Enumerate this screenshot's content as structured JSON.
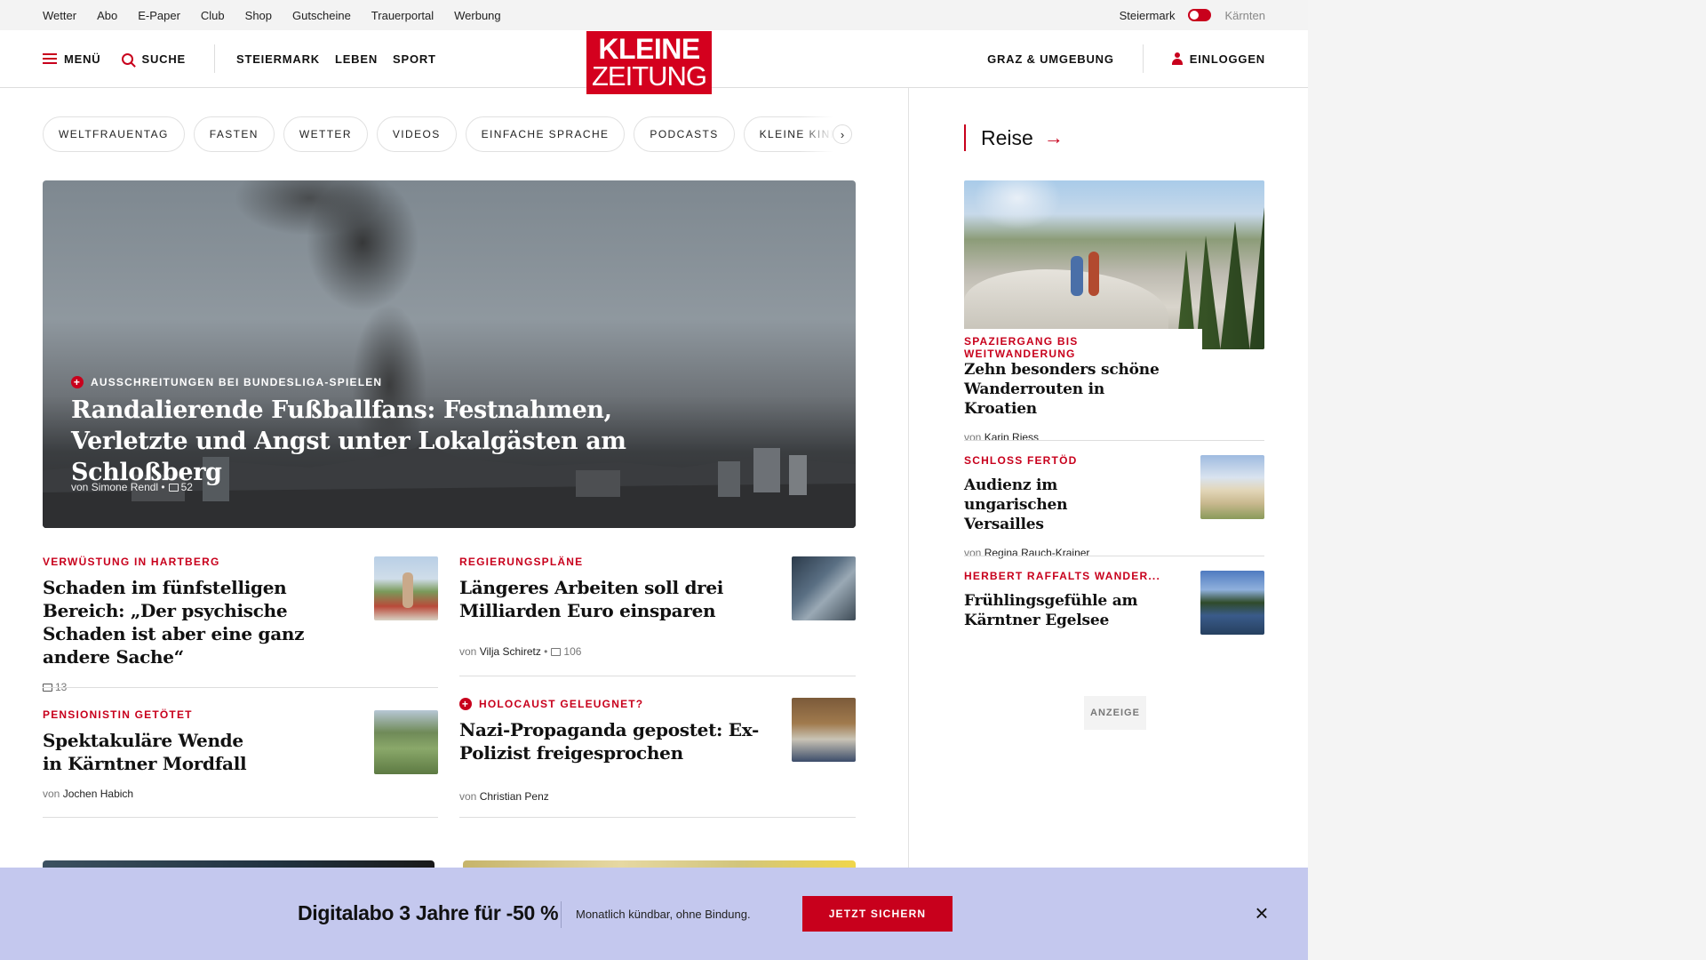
{
  "topbar": {
    "links": [
      "Wetter",
      "Abo",
      "E-Paper",
      "Club",
      "Shop",
      "Gutscheine",
      "Trauerportal",
      "Werbung"
    ],
    "region_active": "Steiermark",
    "region_other": "Kärnten"
  },
  "header": {
    "menu_label": "MENÜ",
    "search_label": "SUCHE",
    "nav": [
      "STEIERMARK",
      "LEBEN",
      "SPORT"
    ],
    "logo_line1": "KLEINE",
    "logo_line2": "ZEITUNG",
    "local_label": "GRAZ & UMGEBUNG",
    "login_label": "EINLOGGEN"
  },
  "tags": [
    "WELTFRAUENTAG",
    "FASTEN",
    "WETTER",
    "VIDEOS",
    "EINFACHE SPRACHE",
    "PODCASTS",
    "KLEINE KINDERZEITUNG"
  ],
  "tags_next_icon": "chevron-right-icon",
  "hero": {
    "kicker": "AUSSCHREITUNGEN BEI BUNDESLIGA-SPIELEN",
    "title": "Randalierende Fußballfans: Festnahmen, Verletzte und Angst unter Lokalgästen am Schloßberg",
    "author_prefix": "von",
    "author": "Simone Rendl",
    "comments": "52"
  },
  "articles": [
    {
      "kicker": "VERWÜSTUNG IN HARTBERG",
      "title": "Schaden im fünfstelligen Bereich: „Der psychische Schaden ist aber eine ganz andere Sache“",
      "comments": "13"
    },
    {
      "kicker": "REGIERUNGSPLÄNE",
      "title": "Längeres Arbeiten soll drei Milliarden Euro einsparen",
      "author_prefix": "von",
      "author": "Vilja Schiretz",
      "comments": "106"
    },
    {
      "kicker": "PENSIONISTIN GETÖTET",
      "title": "Spektakuläre Wende in Kärntner Mordfall",
      "author_prefix": "von",
      "author": "Jochen Habich"
    },
    {
      "kicker": "HOLOCAUST GELEUGNET?",
      "title": "Nazi-Propaganda gepostet: Ex-Polizist freigesprochen",
      "author_prefix": "von",
      "author": "Christian Penz"
    }
  ],
  "sidebar": {
    "section_title": "Reise",
    "section_arrow": "→",
    "featured": {
      "kicker": "SPAZIERGANG BIS WEITWANDERUNG",
      "title": "Zehn besonders schöne Wanderrouten in Kroatien",
      "author_prefix": "von",
      "author": "Karin Riess"
    },
    "items": [
      {
        "kicker": "SCHLOSS FERTÖD",
        "title": "Audienz im ungarischen Versailles",
        "author_prefix": "von",
        "author": "Regina Rauch-Krainer"
      },
      {
        "kicker": "HERBERT RAFFALTS WANDER...",
        "title": "Frühlingsgefühle am Kärntner Egelsee"
      }
    ],
    "ad_label": "ANZEIGE"
  },
  "banner": {
    "title": "Digitalabo 3 Jahre für -50 %",
    "subtitle": "Monatlich kündbar, ohne Bindung.",
    "button": "JETZT SICHERN",
    "close": "×"
  },
  "colors": {
    "brand_red": "#c8001c",
    "banner_bg": "#c4c8ee"
  }
}
